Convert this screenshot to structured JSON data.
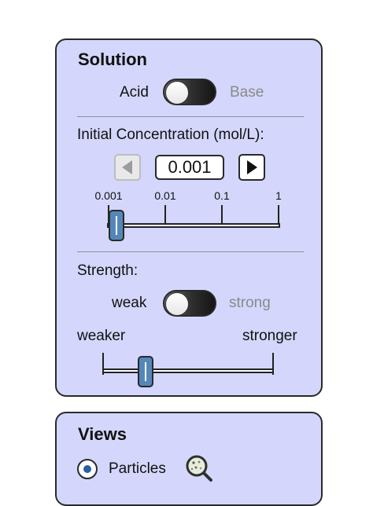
{
  "solution": {
    "title": "Solution",
    "toggle_left": "Acid",
    "toggle_right": "Base",
    "selected": "Acid",
    "concentration_label": "Initial Concentration (mol/L):",
    "concentration_value": "0.001",
    "ticks": [
      "0.001",
      "0.01",
      "0.1",
      "1"
    ],
    "concentration_slider_level": 0.0,
    "strength_label": "Strength:",
    "strength_left": "weak",
    "strength_right": "strong",
    "strength_selected": "weak",
    "weaker_label": "weaker",
    "stronger_label": "stronger",
    "strength_slider_level": 0.25
  },
  "views": {
    "title": "Views",
    "particles_label": "Particles",
    "particles_selected": true
  },
  "icons": {
    "decrement": "left-arrow-icon",
    "increment": "right-arrow-icon",
    "magnifier": "magnifier-icon"
  }
}
